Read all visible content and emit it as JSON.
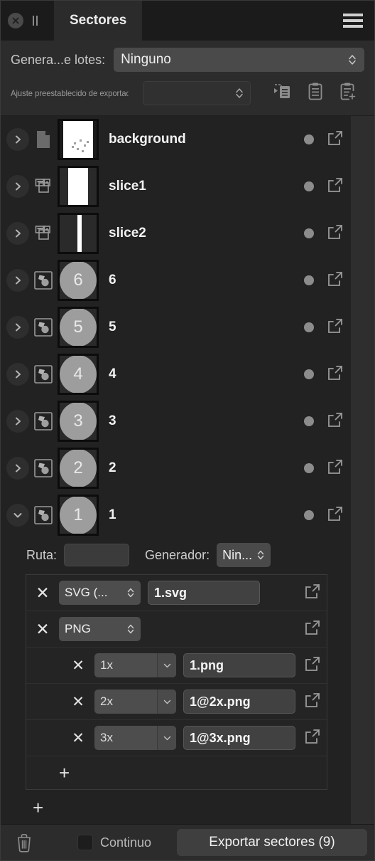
{
  "titlebar": {
    "close_icon": "close-circle-icon",
    "pause_icon": "pause-icon",
    "tab_label": "Sectores",
    "menu_icon": "hamburger-menu-icon"
  },
  "top_controls": {
    "batch_label": "Genera...e lotes:",
    "batch_value": "Ninguno",
    "preset_label": "Ajuste preestablecido de exportac",
    "preset_value": "",
    "icons": [
      {
        "name": "apply-preset-icon"
      },
      {
        "name": "copy-preset-icon"
      },
      {
        "name": "add-preset-icon"
      }
    ]
  },
  "layers": [
    {
      "name": "background",
      "type_icon": "document-icon",
      "thumb": "background",
      "expanded": false,
      "twisty": "chevron-right"
    },
    {
      "name": "slice1",
      "type_icon": "slice-icon",
      "thumb": "slice-wide",
      "expanded": false,
      "twisty": "chevron-right"
    },
    {
      "name": "slice2",
      "type_icon": "slice-icon",
      "thumb": "slice-narrow",
      "expanded": false,
      "twisty": "chevron-right"
    },
    {
      "name": "6",
      "type_icon": "group-icon",
      "thumb": "circle",
      "thumb_label": "6",
      "expanded": false,
      "twisty": "chevron-right"
    },
    {
      "name": "5",
      "type_icon": "group-icon",
      "thumb": "circle",
      "thumb_label": "5",
      "expanded": false,
      "twisty": "chevron-right"
    },
    {
      "name": "4",
      "type_icon": "group-icon",
      "thumb": "circle",
      "thumb_label": "4",
      "expanded": false,
      "twisty": "chevron-right"
    },
    {
      "name": "3",
      "type_icon": "group-icon",
      "thumb": "circle",
      "thumb_label": "3",
      "expanded": false,
      "twisty": "chevron-right"
    },
    {
      "name": "2",
      "type_icon": "group-icon",
      "thumb": "circle",
      "thumb_label": "2",
      "expanded": false,
      "twisty": "chevron-right"
    },
    {
      "name": "1",
      "type_icon": "group-icon",
      "thumb": "circle",
      "thumb_label": "1",
      "expanded": true,
      "twisty": "chevron-down"
    }
  ],
  "detail": {
    "path_label": "Ruta:",
    "path_value": "",
    "generator_label": "Generador:",
    "generator_value": "Nin...",
    "formats": [
      {
        "remove_icon": "x-icon",
        "format": "SVG (...",
        "filename": "1.svg",
        "open_icon": "open-external-icon",
        "children": []
      },
      {
        "remove_icon": "x-icon",
        "format": "PNG",
        "filename": "",
        "open_icon": "open-external-icon",
        "children": [
          {
            "remove_icon": "x-icon",
            "scale": "1x",
            "filename": "1.png",
            "open_icon": "open-external-icon"
          },
          {
            "remove_icon": "x-icon",
            "scale": "2x",
            "filename": "1@2x.png",
            "open_icon": "open-external-icon"
          },
          {
            "remove_icon": "x-icon",
            "scale": "3x",
            "filename": "1@3x.png",
            "open_icon": "open-external-icon"
          }
        ]
      }
    ],
    "add_child_label": "+",
    "add_format_label": "+"
  },
  "bottombar": {
    "trash_icon": "trash-icon",
    "continuous_label": "Continuo",
    "continuous_checked": false,
    "export_label": "Exportar sectores (9)"
  },
  "colors": {
    "panel_bg": "#252525",
    "list_bg": "#222222",
    "titlebar_bg": "#1b1b1b",
    "tab_bg": "#2b2b2b",
    "control_bg": "#4a4a4a",
    "text": "#e9e9e9",
    "muted_text": "#9a9a9a",
    "thumb_circle": "#9d9d9d"
  }
}
